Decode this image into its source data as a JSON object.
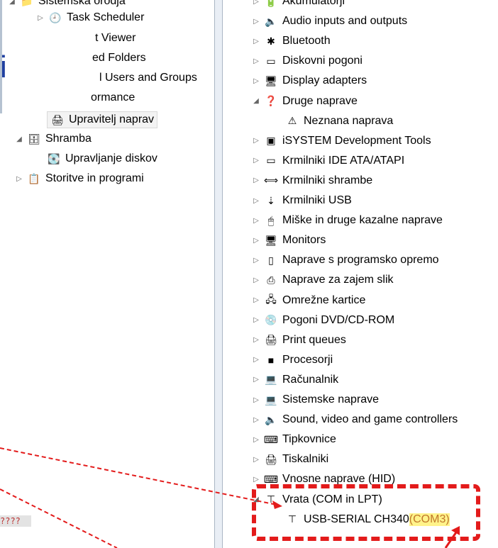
{
  "left_tree": [
    {
      "label": "Sistemska orodja",
      "icon": "folder-icon",
      "expander": "open"
    },
    {
      "label": "Task Scheduler",
      "icon": "clock-icon",
      "expander": "closed"
    },
    {
      "label": "t Viewer",
      "icon": "",
      "expander": ""
    },
    {
      "label": "ed Folders",
      "icon": "",
      "expander": ""
    },
    {
      "label": "l Users and Groups",
      "icon": "",
      "expander": ""
    },
    {
      "label": "ormance",
      "icon": "",
      "expander": ""
    },
    {
      "label": "Upravitelj naprav",
      "icon": "device-manager-icon",
      "expander": "",
      "selected": true
    },
    {
      "label": "Shramba",
      "icon": "storage-icon",
      "expander": "open"
    },
    {
      "label": "Upravljanje diskov",
      "icon": "disk-management-icon",
      "expander": ""
    },
    {
      "label": "Storitve in programi",
      "icon": "services-icon",
      "expander": "closed"
    }
  ],
  "overlay_letter": "i",
  "garbled_text": "????",
  "device_tree": [
    {
      "label": "Akumulatorji",
      "icon": "battery-icon",
      "expander": "closed"
    },
    {
      "label": "Audio inputs and outputs",
      "icon": "speaker-icon",
      "expander": "closed"
    },
    {
      "label": "Bluetooth",
      "icon": "bluetooth-icon",
      "expander": "closed"
    },
    {
      "label": "Diskovni pogoni",
      "icon": "disk-drive-icon",
      "expander": "closed"
    },
    {
      "label": "Display adapters",
      "icon": "display-adapter-icon",
      "expander": "closed"
    },
    {
      "label": "Druge naprave",
      "icon": "unknown-device-icon",
      "expander": "open"
    },
    {
      "label": "Neznana naprava",
      "icon": "warning-device-icon",
      "expander": "",
      "child": true
    },
    {
      "label": "iSYSTEM Development Tools",
      "icon": "chip-tool-icon",
      "expander": "closed"
    },
    {
      "label": "Krmilniki IDE ATA/ATAPI",
      "icon": "ide-controller-icon",
      "expander": "closed"
    },
    {
      "label": "Krmilniki shrambe",
      "icon": "storage-controller-icon",
      "expander": "closed"
    },
    {
      "label": "Krmilniki USB",
      "icon": "usb-icon",
      "expander": "closed"
    },
    {
      "label": "Miške in druge kazalne naprave",
      "icon": "mouse-icon",
      "expander": "closed"
    },
    {
      "label": "Monitors",
      "icon": "monitor-icon",
      "expander": "closed"
    },
    {
      "label": "Naprave s programsko opremo",
      "icon": "software-device-icon",
      "expander": "closed"
    },
    {
      "label": "Naprave za zajem slik",
      "icon": "scanner-icon",
      "expander": "closed"
    },
    {
      "label": "Omrežne kartice",
      "icon": "network-icon",
      "expander": "closed"
    },
    {
      "label": "Pogoni DVD/CD-ROM",
      "icon": "dvd-icon",
      "expander": "closed"
    },
    {
      "label": "Print queues",
      "icon": "printer-icon",
      "expander": "closed"
    },
    {
      "label": "Procesorji",
      "icon": "cpu-icon",
      "expander": "closed"
    },
    {
      "label": "Računalnik",
      "icon": "computer-icon",
      "expander": "closed"
    },
    {
      "label": "Sistemske naprave",
      "icon": "system-device-icon",
      "expander": "closed"
    },
    {
      "label": "Sound, video and game controllers",
      "icon": "speaker-icon",
      "expander": "closed"
    },
    {
      "label": "Tipkovnice",
      "icon": "keyboard-icon",
      "expander": "closed"
    },
    {
      "label": "Tiskalniki",
      "icon": "printer-icon",
      "expander": "closed"
    },
    {
      "label": "Vnosne naprave (HID)",
      "icon": "hid-icon",
      "expander": "closed"
    },
    {
      "label": "Vrata (COM in LPT)",
      "icon": "port-icon",
      "expander": "open"
    },
    {
      "label": "USB-SERIAL CH340",
      "highlight": "(COM3)",
      "icon": "port-icon",
      "expander": "",
      "child": true
    }
  ],
  "colors": {
    "annotation": "#e31b1b",
    "highlight": "#fff38a",
    "highlight_text": "#c0772c"
  }
}
